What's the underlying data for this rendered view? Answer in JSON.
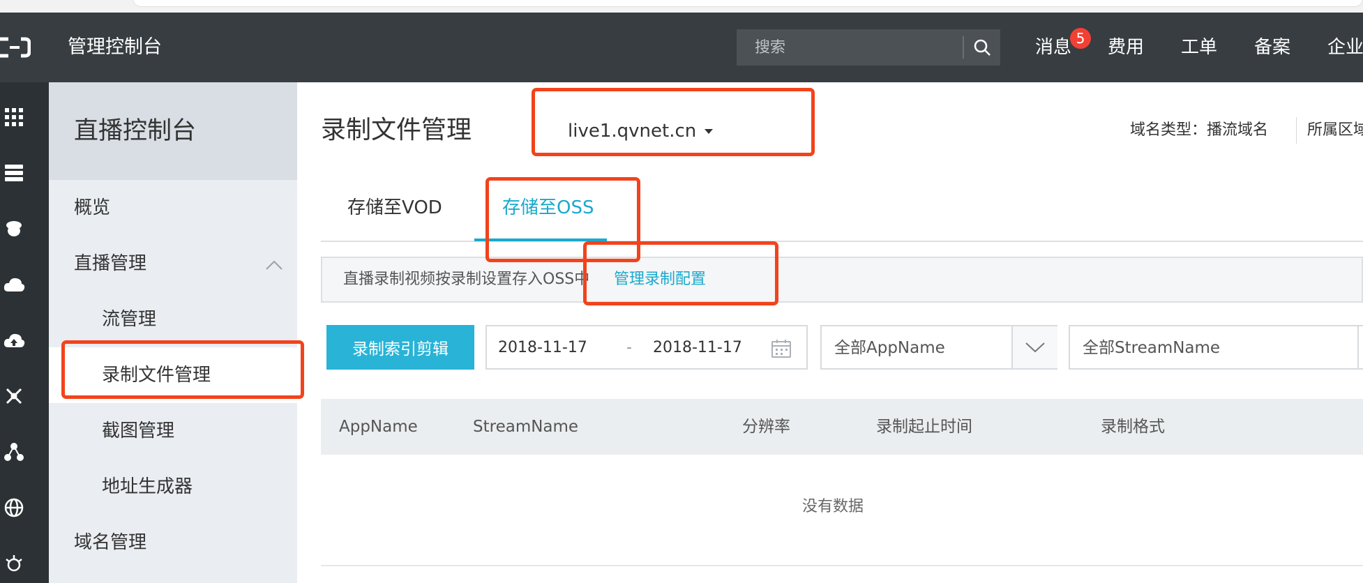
{
  "topbar": {
    "console_title": "管理控制台",
    "search_placeholder": "搜索",
    "nav": [
      "消息",
      "费用",
      "工单",
      "备案",
      "企业"
    ],
    "message_badge": "5"
  },
  "sidebar": {
    "title": "直播控制台",
    "items": [
      {
        "label": "概览"
      },
      {
        "label": "直播管理"
      },
      {
        "label": "流管理"
      },
      {
        "label": "录制文件管理"
      },
      {
        "label": "截图管理"
      },
      {
        "label": "地址生成器"
      },
      {
        "label": "域名管理"
      }
    ]
  },
  "main": {
    "page_title": "录制文件管理",
    "domain": "live1.qvnet.cn",
    "domain_type": "域名类型：播流域名",
    "region": "所属区域",
    "tabs": [
      {
        "label": "存储至VOD"
      },
      {
        "label": "存储至OSS"
      }
    ],
    "notice_text": "直播录制视频按录制设置存入OSS中",
    "notice_link": "管理录制配置",
    "edit_button": "录制索引剪辑",
    "date_start": "2018-11-17",
    "date_sep": "-",
    "date_end": "2018-11-17",
    "app_select": "全部AppName",
    "stream_select": "全部StreamName",
    "table": {
      "columns": [
        "AppName",
        "StreamName",
        "分辨率",
        "录制起止时间",
        "录制格式"
      ],
      "empty": "没有数据"
    }
  },
  "colors": {
    "topbar_bg": "#373d41",
    "accent": "#1aa9ce",
    "button_bg": "#28b3d7",
    "highlight": "#f2431c",
    "badge": "#f04134"
  }
}
